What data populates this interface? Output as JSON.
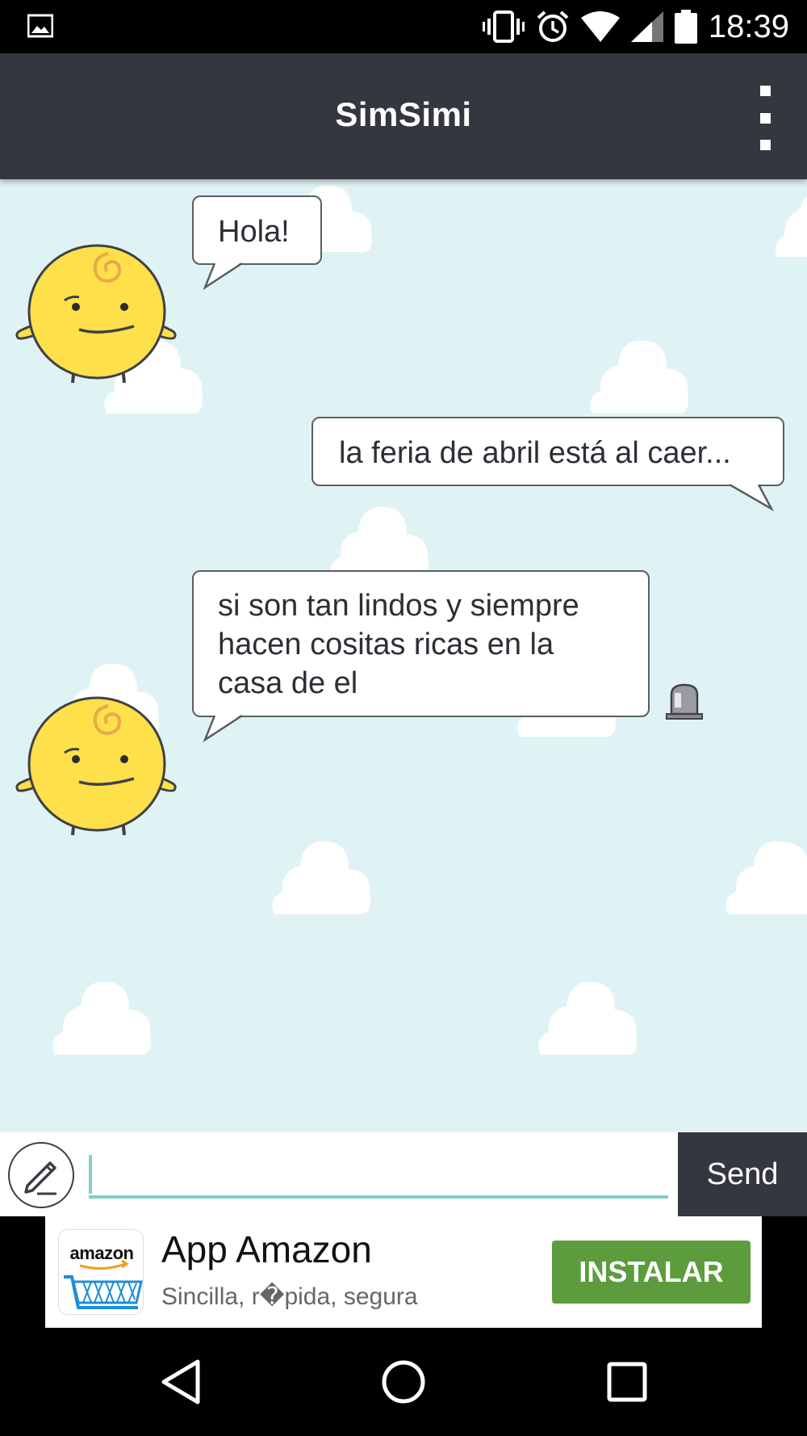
{
  "status_bar": {
    "time": "18:39",
    "icons": [
      "image-notification-icon",
      "vibrate-icon",
      "alarm-icon",
      "wifi-icon",
      "signal-icon",
      "battery-icon"
    ]
  },
  "app_bar": {
    "title": "SimSimi",
    "menu_icon": "overflow-menu-icon"
  },
  "chat": {
    "messages": [
      {
        "sender": "bot",
        "text": "Hola!"
      },
      {
        "sender": "user",
        "text": "la feria de abril está al caer..."
      },
      {
        "sender": "bot",
        "lines": [
          "si son tan lindos y siempre",
          "hacen cositas ricas en la",
          "casa de el"
        ]
      }
    ],
    "report_icon": "siren-report-icon",
    "background_color": "#e0f3f4"
  },
  "input_bar": {
    "value": "",
    "send_label": "Send",
    "accent_color": "#7fcfc6"
  },
  "ad": {
    "logo_text": "amazon",
    "title": "App Amazon",
    "subtitle": "Sincilla, r�pida, segura",
    "install_label": "INSTALAR",
    "install_color": "#5c9c3c"
  },
  "nav_bar": {
    "buttons": [
      "back-icon",
      "home-icon",
      "recents-icon"
    ]
  },
  "colors": {
    "app_bar": "#343640",
    "bubble_border": "#5a5d66",
    "avatar_yellow": "#fde04a"
  }
}
